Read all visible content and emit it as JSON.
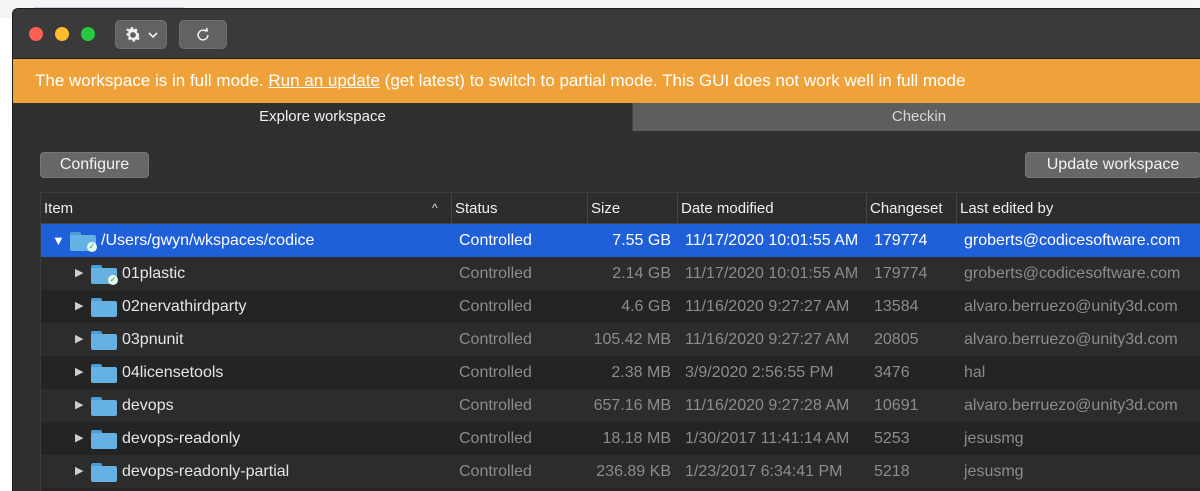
{
  "toolbar": {
    "gear_icon": "gear-icon",
    "chevron_icon": "chevron-down-icon",
    "refresh_icon": "refresh-icon"
  },
  "banner": {
    "text_before": "The workspace is in full mode. ",
    "link_text": "Run an update",
    "text_after": " (get latest) to switch to partial mode. This GUI does not work well in full mode",
    "color": "#f0a23a"
  },
  "tabs": [
    {
      "label": "Explore workspace",
      "active": true
    },
    {
      "label": "Checkin",
      "active": false
    }
  ],
  "buttons": {
    "configure": "Configure",
    "update_workspace": "Update workspace"
  },
  "table": {
    "columns": [
      "Item",
      "Status",
      "Size",
      "Date modified",
      "Changeset",
      "Last edited by"
    ],
    "rows": [
      {
        "name": "/Users/gwyn/wkspaces/codice",
        "status": "Controlled",
        "size": "7.55 GB",
        "date": "11/17/2020 10:01:55 AM",
        "changeset": "179774",
        "editor": "groberts@codicesoftware.com"
      },
      {
        "name": "01plastic",
        "status": "Controlled",
        "size": "2.14 GB",
        "date": "11/17/2020 10:01:55 AM",
        "changeset": "179774",
        "editor": "groberts@codicesoftware.com"
      },
      {
        "name": "02nervathirdparty",
        "status": "Controlled",
        "size": "4.6 GB",
        "date": "11/16/2020 9:27:27 AM",
        "changeset": "13584",
        "editor": "alvaro.berruezo@unity3d.com"
      },
      {
        "name": "03pnunit",
        "status": "Controlled",
        "size": "105.42 MB",
        "date": "11/16/2020 9:27:27 AM",
        "changeset": "20805",
        "editor": "alvaro.berruezo@unity3d.com"
      },
      {
        "name": "04licensetools",
        "status": "Controlled",
        "size": "2.38 MB",
        "date": "3/9/2020 2:56:55 PM",
        "changeset": "3476",
        "editor": "hal"
      },
      {
        "name": "devops",
        "status": "Controlled",
        "size": "657.16 MB",
        "date": "11/16/2020 9:27:28 AM",
        "changeset": "10691",
        "editor": "alvaro.berruezo@unity3d.com"
      },
      {
        "name": "devops-readonly",
        "status": "Controlled",
        "size": "18.18 MB",
        "date": "1/30/2017 11:41:14 AM",
        "changeset": "5253",
        "editor": "jesusmg"
      },
      {
        "name": "devops-readonly-partial",
        "status": "Controlled",
        "size": "236.89 KB",
        "date": "1/23/2017 6:34:41 PM",
        "changeset": "5218",
        "editor": "jesusmg"
      }
    ]
  }
}
